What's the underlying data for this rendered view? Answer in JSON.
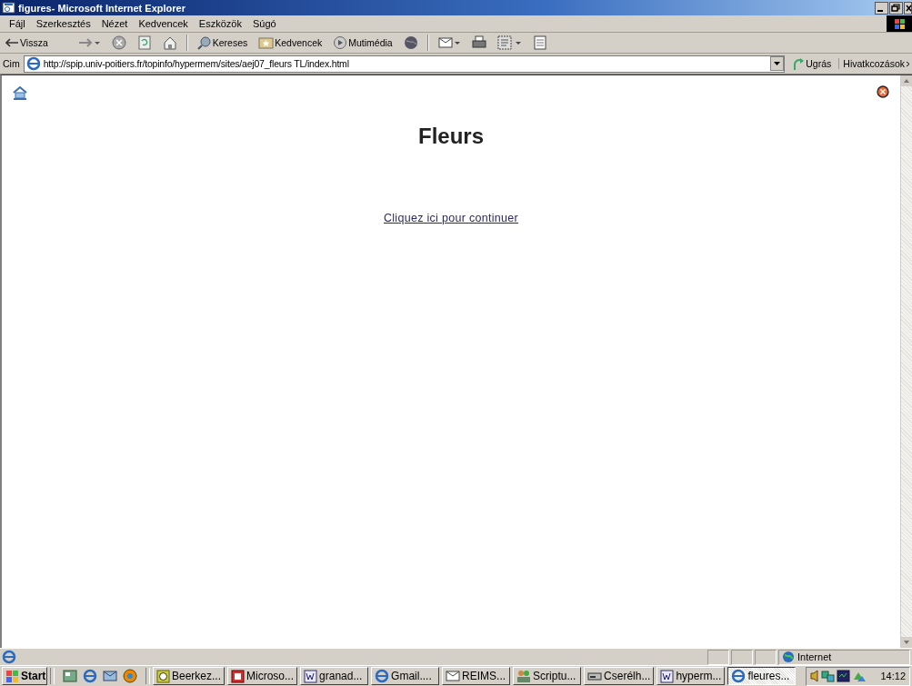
{
  "window": {
    "title": "figures- Microsoft Internet Explorer"
  },
  "menu": [
    "Fájl",
    "Szerkesztés",
    "Nézet",
    "Kedvencek",
    "Eszközök",
    "Súgó"
  ],
  "toolbar": [
    {
      "kind": "back",
      "label": "Vissza"
    },
    {
      "kind": "forward"
    },
    {
      "kind": "stop"
    },
    {
      "kind": "refresh"
    },
    {
      "kind": "home"
    },
    {
      "kind": "sep"
    },
    {
      "kind": "search",
      "label": "Kereses"
    },
    {
      "kind": "favorites",
      "label": "Kedvencek"
    },
    {
      "kind": "media",
      "label": "Mutimédia"
    },
    {
      "kind": "history"
    },
    {
      "kind": "sep"
    },
    {
      "kind": "mail"
    },
    {
      "kind": "print"
    },
    {
      "kind": "edit"
    },
    {
      "kind": "discuss"
    }
  ],
  "address": {
    "label": "Cim",
    "value": "http://spip.univ-poitiers.fr/topinfo/hypermem/sites/aej07_fleurs TL/index.html",
    "go": "Ugrás",
    "links": "Hivatkcozások"
  },
  "page": {
    "title": "Fleurs",
    "link": "Cliquez ici pour continuer"
  },
  "status_bar": {
    "zone": "Internet"
  },
  "taskbar": {
    "start": "Start",
    "tasks": [
      {
        "kind": "calendar",
        "label": "Beerkez...",
        "selected": false
      },
      {
        "kind": "slides",
        "label": "Microso...",
        "selected": false
      },
      {
        "kind": "doc",
        "label": "granad...",
        "selected": false
      },
      {
        "kind": "browser",
        "label": "Gmail....",
        "selected": false
      },
      {
        "kind": "envelope",
        "label": "REIMS...",
        "selected": false
      },
      {
        "kind": "people",
        "label": "Scriptu...",
        "selected": false
      },
      {
        "kind": "drive",
        "label": "Cserélh...",
        "selected": false
      },
      {
        "kind": "doc",
        "label": "hyperm...",
        "selected": false
      },
      {
        "kind": "browser",
        "label": "fleures...",
        "selected": true
      }
    ],
    "clock": "14:12"
  }
}
